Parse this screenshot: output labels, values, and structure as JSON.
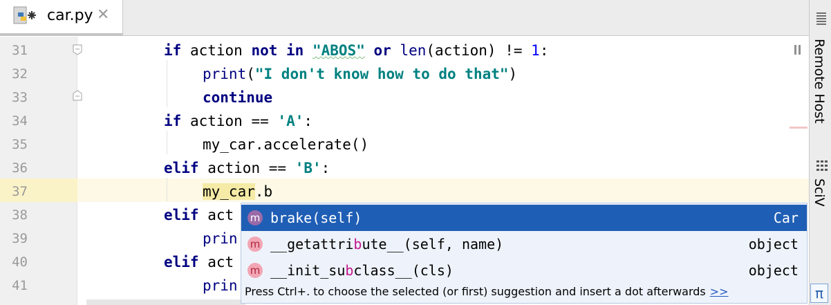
{
  "tab": {
    "file_name": "car.py",
    "close_glyph": "✕",
    "icon": "python-file-icon"
  },
  "right_strip": {
    "remote_host_label": "Remote Host",
    "sciview_label": "SciView",
    "pi_glyph": "π"
  },
  "editor": {
    "current_line": 37,
    "lines": [
      {
        "number": "31"
      },
      {
        "number": "32"
      },
      {
        "number": "33"
      },
      {
        "number": "34"
      },
      {
        "number": "35"
      },
      {
        "number": "36"
      },
      {
        "number": "37"
      },
      {
        "number": "38"
      },
      {
        "number": "39"
      },
      {
        "number": "40"
      },
      {
        "number": "41"
      }
    ],
    "tokens": {
      "if": "if",
      "action": "action",
      "not_in": "not in",
      "abos": "\"ABOS\"",
      "or": "or",
      "len": "len",
      "len_args": "(action)",
      "ne": "!=",
      "one": "1",
      "colon": ":",
      "print": "print",
      "paren_open": "(",
      "paren_close": ")",
      "dont_know": "\"I don't know how to do that\"",
      "continue": "continue",
      "eq": "==",
      "str_a": "'A'",
      "str_b": "'B'",
      "accelerate": "my_car.accelerate()",
      "elif": "elif",
      "my_car": "my_car",
      "dot_b": ".b",
      "act_trunc": "act",
      "prin_trunc": "prin"
    }
  },
  "completion": {
    "items": [
      {
        "pre": "",
        "hl": "b",
        "post": "rake(self)",
        "type": "Car",
        "badge": "m",
        "selected": true
      },
      {
        "pre": "__getattri",
        "hl": "b",
        "post": "ute__(self, name)",
        "type": "object",
        "badge": "m",
        "selected": false
      },
      {
        "pre": "__init_su",
        "hl": "b",
        "post": "class__(cls)",
        "type": "object",
        "badge": "m",
        "selected": false
      }
    ],
    "hint": "Press Ctrl+. to choose the selected (or first) suggestion and insert a dot afterwards",
    "hint_link": ">>"
  },
  "colors": {
    "selection": "#1f5eb5",
    "keyword": "#000080",
    "string": "#008080",
    "number": "#0000ff"
  }
}
